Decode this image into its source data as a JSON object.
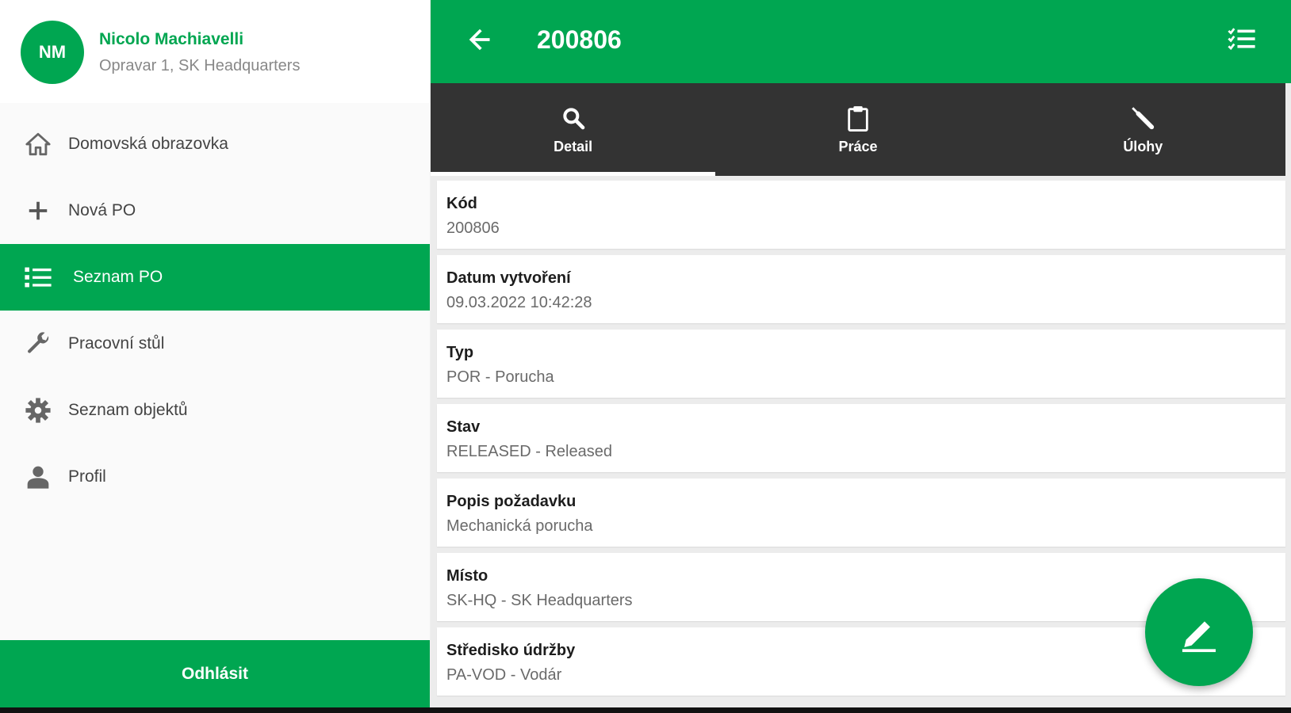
{
  "user": {
    "initials": "NM",
    "name": "Nicolo Machiavelli",
    "subtitle": "Opravar 1, SK Headquarters"
  },
  "menu": {
    "items": [
      {
        "label": "Domovská obrazovka",
        "icon": "home-icon"
      },
      {
        "label": "Nová PO",
        "icon": "plus-icon"
      },
      {
        "label": "Seznam PO",
        "icon": "list-icon",
        "active": true
      },
      {
        "label": "Pracovní stůl",
        "icon": "wrench-icon"
      },
      {
        "label": "Seznam objektů",
        "icon": "gear-icon"
      },
      {
        "label": "Profil",
        "icon": "person-icon"
      }
    ],
    "logout_label": "Odhlásit"
  },
  "appbar": {
    "title": "200806",
    "back_icon": "arrow-left-icon",
    "action_icon": "checklist-icon"
  },
  "tabs": [
    {
      "label": "Detail",
      "icon": "search-icon",
      "active": true
    },
    {
      "label": "Práce",
      "icon": "clipboard-icon"
    },
    {
      "label": "Úlohy",
      "icon": "screwdriver-icon"
    }
  ],
  "details": [
    {
      "label": "Kód",
      "value": "200806"
    },
    {
      "label": "Datum vytvoření",
      "value": "09.03.2022 10:42:28"
    },
    {
      "label": "Typ",
      "value": "POR - Porucha"
    },
    {
      "label": "Stav",
      "value": "RELEASED - Released"
    },
    {
      "label": "Popis požadavku",
      "value": "Mechanická porucha"
    },
    {
      "label": "Místo",
      "value": "SK-HQ - SK Headquarters"
    },
    {
      "label": "Středisko údržby",
      "value": "PA-VOD - Vodár"
    }
  ],
  "fab_icon": "edit-icon",
  "colors": {
    "accent": "#00a651",
    "tabbar": "#333333",
    "background": "#ececec"
  }
}
